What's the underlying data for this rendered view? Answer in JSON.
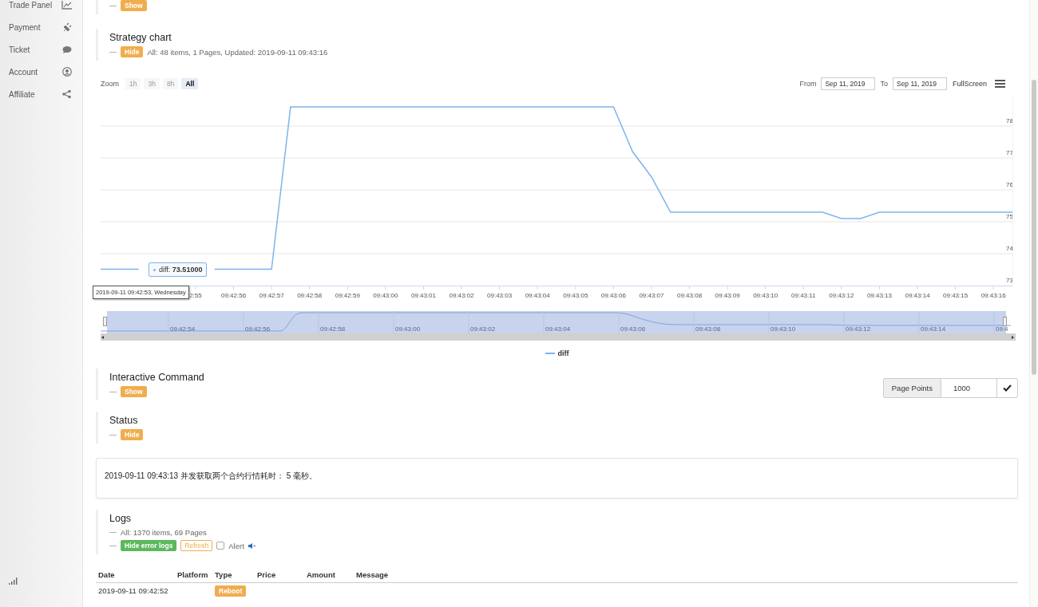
{
  "sidebar": {
    "items": [
      {
        "label": "Trade Panel"
      },
      {
        "label": "Payment"
      },
      {
        "label": "Ticket"
      },
      {
        "label": "Account"
      },
      {
        "label": "Affiliate"
      }
    ]
  },
  "top_section": {
    "dash": "—",
    "toggle": "Show"
  },
  "strategy_chart": {
    "title": "Strategy chart",
    "dash": "—",
    "toggle": "Hide",
    "info": "All: 48 items, 1 Pages, Updated: 2019-09-11 09:43:16",
    "zoom": {
      "label": "Zoom",
      "buttons": [
        {
          "label": "1h",
          "selected": false
        },
        {
          "label": "3h",
          "selected": false
        },
        {
          "label": "8h",
          "selected": false
        },
        {
          "label": "All",
          "selected": true
        }
      ]
    },
    "from_label": "From",
    "from_value": "Sep 11, 2019",
    "to_label": "To",
    "to_value": "Sep 11, 2019",
    "fullscreen": "FullScreen",
    "chart_data": {
      "type": "line",
      "categories": [
        null,
        null,
        null,
        null,
        null,
        "2:55",
        null,
        "09:42:56",
        null,
        "09:42:57",
        null,
        "09:42:58",
        null,
        "09:42:59",
        null,
        "09:43:00",
        null,
        "09:43:01",
        null,
        "09:43:02",
        null,
        "09:43:03",
        null,
        "09:43:04",
        null,
        "09:43:05",
        null,
        "09:43:06",
        null,
        "09:43:07",
        null,
        "09:43:08",
        null,
        "09:43:09",
        null,
        "09:43:10",
        null,
        "09:43:11",
        null,
        "09:43:12",
        null,
        "09:43:13",
        null,
        "09:43:14",
        null,
        "09:43:15",
        null,
        "09:43:16",
        null
      ],
      "series": [
        {
          "name": "diff",
          "color": "#7cb5ec",
          "values": [
            73.51,
            73.51,
            73.51,
            null,
            null,
            null,
            73.51,
            73.51,
            73.51,
            73.51,
            78.6,
            78.6,
            78.6,
            78.6,
            78.6,
            78.6,
            78.6,
            78.6,
            78.6,
            78.6,
            78.6,
            78.6,
            78.6,
            78.6,
            78.6,
            78.6,
            78.6,
            78.6,
            77.2,
            76.4,
            75.3,
            75.3,
            75.3,
            75.3,
            75.3,
            75.3,
            75.3,
            75.3,
            75.3,
            75.1,
            75.1,
            75.3,
            75.3,
            75.3,
            75.3,
            75.3,
            75.3,
            75.3,
            75.3
          ]
        }
      ],
      "ylim": [
        73,
        78.9
      ],
      "yticks": [
        73,
        74,
        75,
        76,
        77,
        78
      ],
      "grid": true
    },
    "tooltip": {
      "date": "2019-09-11 09:42:53, Wednesday",
      "text": "diff: **73.51000**"
    },
    "navigator": {
      "labels": [
        "09:42:54",
        "09:42:56",
        "09:42:58",
        "09:43:00",
        "09:43:02",
        "09:43:04",
        "09:43:06",
        "09:43:08",
        "09:43:10",
        "09:43:12",
        "09:43:14",
        "09:4"
      ]
    }
  },
  "interactive_command": {
    "title": "Interactive Command",
    "dash": "—",
    "toggle": "Show",
    "page_points": {
      "label": "Page Points",
      "value": "1000"
    }
  },
  "status": {
    "title": "Status",
    "dash": "—",
    "toggle": "Hide",
    "message": "2019-09-11 09:43:13 并发获取两个合约行情耗时： 5 毫秒。"
  },
  "logs": {
    "title": "Logs",
    "dash": "—",
    "info": "All: 1370 items, 69 Pages",
    "dash_2": "—",
    "hide_errors": "Hide error logs",
    "refresh": "Refresh",
    "alert": {
      "label": "Alert",
      "checked": false
    },
    "table": {
      "columns": [
        "Date",
        "Platform",
        "Type",
        "Price",
        "Amount",
        "Message"
      ],
      "rows": [
        {
          "cells": [
            "2019-09-11 09:42:52",
            "",
            "Reboot",
            "",
            "",
            ""
          ]
        }
      ]
    }
  }
}
